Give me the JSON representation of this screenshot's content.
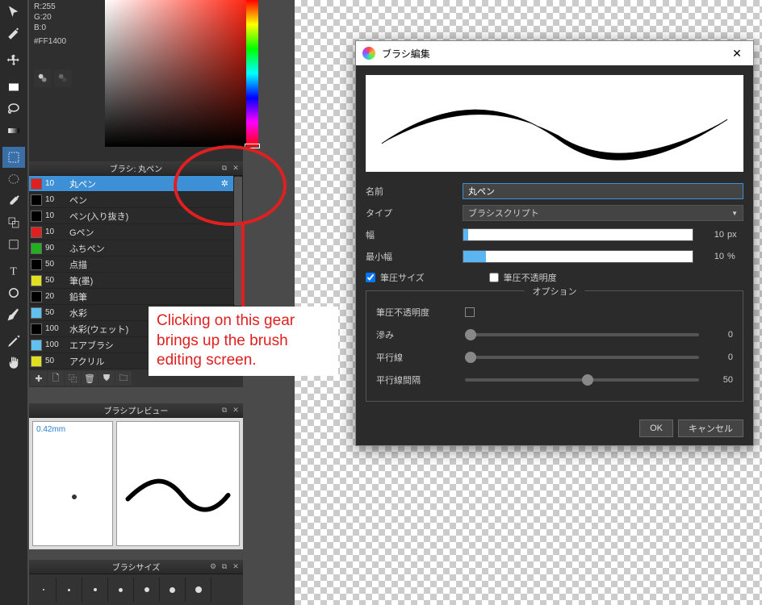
{
  "color_panel": {
    "r": "R:255",
    "g": "G:20",
    "b": "B:0",
    "hex": "#FF1400"
  },
  "brush_panel": {
    "title": "ブラシ: 丸ペン",
    "items": [
      {
        "color": "#e02020",
        "size": "10",
        "name": "丸ペン",
        "selected": true
      },
      {
        "color": "#000000",
        "size": "10",
        "name": "ペン"
      },
      {
        "color": "#000000",
        "size": "10",
        "name": "ペン(入り抜き)"
      },
      {
        "color": "#e02020",
        "size": "10",
        "name": "Gペン"
      },
      {
        "color": "#20b020",
        "size": "90",
        "name": "ふちペン"
      },
      {
        "color": "#000000",
        "size": "50",
        "name": "点描"
      },
      {
        "color": "#e0e020",
        "size": "50",
        "name": "筆(墨)"
      },
      {
        "color": "#000000",
        "size": "20",
        "name": "鉛筆"
      },
      {
        "color": "#60c0f0",
        "size": "50",
        "name": "水彩"
      },
      {
        "color": "#000000",
        "size": "100",
        "name": "水彩(ウェット)"
      },
      {
        "color": "#60c0f0",
        "size": "100",
        "name": "エアブラシ"
      },
      {
        "color": "#e0e020",
        "size": "50",
        "name": "アクリル"
      }
    ]
  },
  "preview_panel": {
    "title": "ブラシプレビュー",
    "size_label": "0.42mm"
  },
  "size_panel": {
    "title": "ブラシサイズ",
    "sizes": [
      1,
      2,
      3,
      4,
      5,
      6,
      7
    ]
  },
  "annotation": {
    "text": "Clicking on this gear brings up the brush editing screen."
  },
  "dialog": {
    "title": "ブラシ編集",
    "name_label": "名前",
    "name_value": "丸ペン",
    "type_label": "タイプ",
    "type_value": "ブラシスクリプト",
    "width_label": "幅",
    "width_value": "10",
    "width_unit": "px",
    "width_fill_pct": 2,
    "minwidth_label": "最小幅",
    "minwidth_value": "10",
    "minwidth_unit": "%",
    "minwidth_fill_pct": 10,
    "check_pressure_size": "筆圧サイズ",
    "check_pressure_opacity": "筆圧不透明度",
    "options_title": "オプション",
    "options": [
      {
        "label": "筆圧不透明度",
        "type": "check"
      },
      {
        "label": "滲み",
        "value": "0",
        "pos": 0
      },
      {
        "label": "平行線",
        "value": "0",
        "pos": 0
      },
      {
        "label": "平行線間隔",
        "value": "50",
        "pos": 50
      }
    ],
    "ok": "OK",
    "cancel": "キャンセル"
  }
}
